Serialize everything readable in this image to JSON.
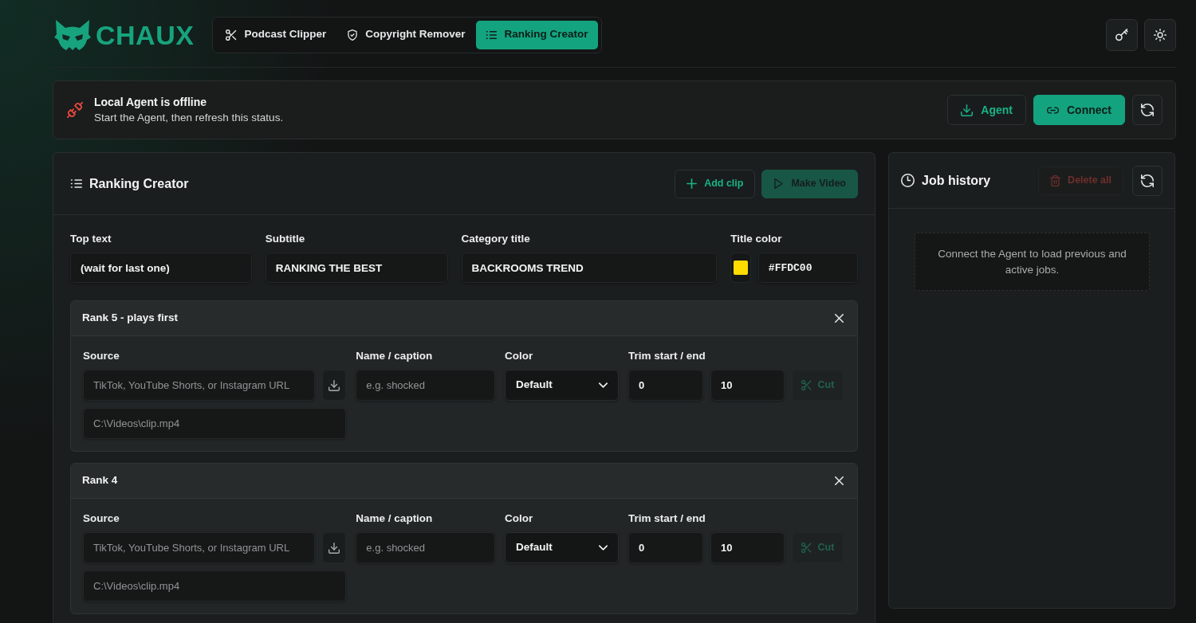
{
  "brand": {
    "name": "CHAUX"
  },
  "nav_tabs": [
    {
      "label": "Podcast Clipper",
      "selected": false
    },
    {
      "label": "Copyright Remover",
      "selected": false
    },
    {
      "label": "Ranking Creator",
      "selected": true
    }
  ],
  "agent_status": {
    "online": false,
    "title": "Local Agent is offline",
    "message": "Start the Agent, then refresh this status.",
    "buttons": [
      {
        "label": "Agent",
        "kind": "outline"
      },
      {
        "label": "Connect",
        "kind": "primary"
      }
    ]
  },
  "ranking_creator": {
    "title": "Ranking Creator",
    "actions": [
      {
        "label": "Add clip",
        "kind": "outline",
        "disabled": false
      },
      {
        "label": "Make Video",
        "kind": "primary",
        "disabled": true
      }
    ],
    "fields": [
      {
        "label": "Top text",
        "value": "(wait for last one)"
      },
      {
        "label": "Subtitle",
        "value": "RANKING THE BEST"
      },
      {
        "label": "Category title",
        "value": "BACKROOMS TREND"
      }
    ],
    "title_color": {
      "label": "Title color",
      "value": "#FFDC00"
    },
    "clips": [
      {
        "title": "Rank 5 - plays first",
        "source": {
          "label": "Source",
          "placeholder": "TikTok, YouTube Shorts, or Instagram URL",
          "path_placeholder": "C:\\Videos\\clip.mp4"
        },
        "caption": {
          "label": "Name / caption",
          "placeholder": "e.g. shocked"
        },
        "color_select": {
          "label": "Color",
          "value": "Default"
        },
        "trim": {
          "label": "Trim start / end",
          "start": "0",
          "end": "10"
        },
        "cut": {
          "label": "Cut",
          "disabled": true
        }
      },
      {
        "title": "Rank 4",
        "source": {
          "label": "Source",
          "placeholder": "TikTok, YouTube Shorts, or Instagram URL",
          "path_placeholder": "C:\\Videos\\clip.mp4"
        },
        "caption": {
          "label": "Name / caption",
          "placeholder": "e.g. shocked"
        },
        "color_select": {
          "label": "Color",
          "value": "Default"
        },
        "trim": {
          "label": "Trim start / end",
          "start": "0",
          "end": "10"
        },
        "cut": {
          "label": "Cut",
          "disabled": true
        }
      }
    ]
  },
  "job_history": {
    "title": "Job history",
    "delete_all": {
      "label": "Delete all",
      "disabled": true
    },
    "empty_message": "Connect the Agent to load previous and active jobs."
  }
}
